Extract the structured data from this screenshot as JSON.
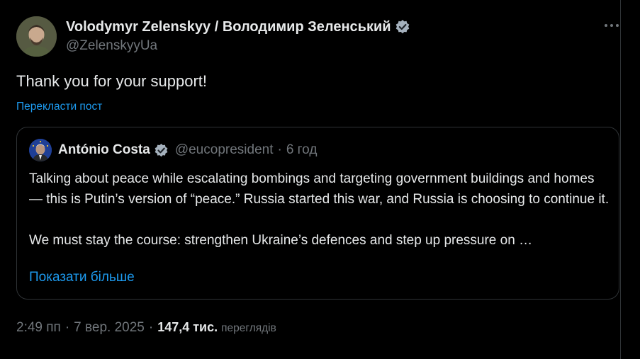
{
  "tweet": {
    "author_name": "Volodymyr Zelenskyy / Володимир Зеленський",
    "author_handle": "@ZelenskyyUa",
    "text": "Thank you for your support!",
    "translate_label": "Перекласти пост",
    "timestamp_time": "2:49 пп",
    "timestamp_date": "7 вер. 2025",
    "separator": "·",
    "views_count": "147,4 тис.",
    "views_label": "переглядів",
    "more_icon": "more-horizontal-icon",
    "verified_icon": "verified-badge-icon"
  },
  "quote": {
    "author_name": "António Costa",
    "author_handle": "@eucopresident",
    "separator": "·",
    "time_ago": "6 год",
    "paragraph1": "Talking about peace while escalating bombings and targeting government buildings and homes — this is Putin’s version of “peace.” Russia started this war, and Russia is choosing to continue it.",
    "paragraph2": "We must stay the course: strengthen Ukraine’s defences and step up pressure on …",
    "show_more_label": "Показати більше"
  },
  "colors": {
    "background": "#000000",
    "text_primary": "#e7e9ea",
    "text_secondary": "#71767b",
    "accent": "#1d9bf0",
    "border": "#2f3336"
  }
}
